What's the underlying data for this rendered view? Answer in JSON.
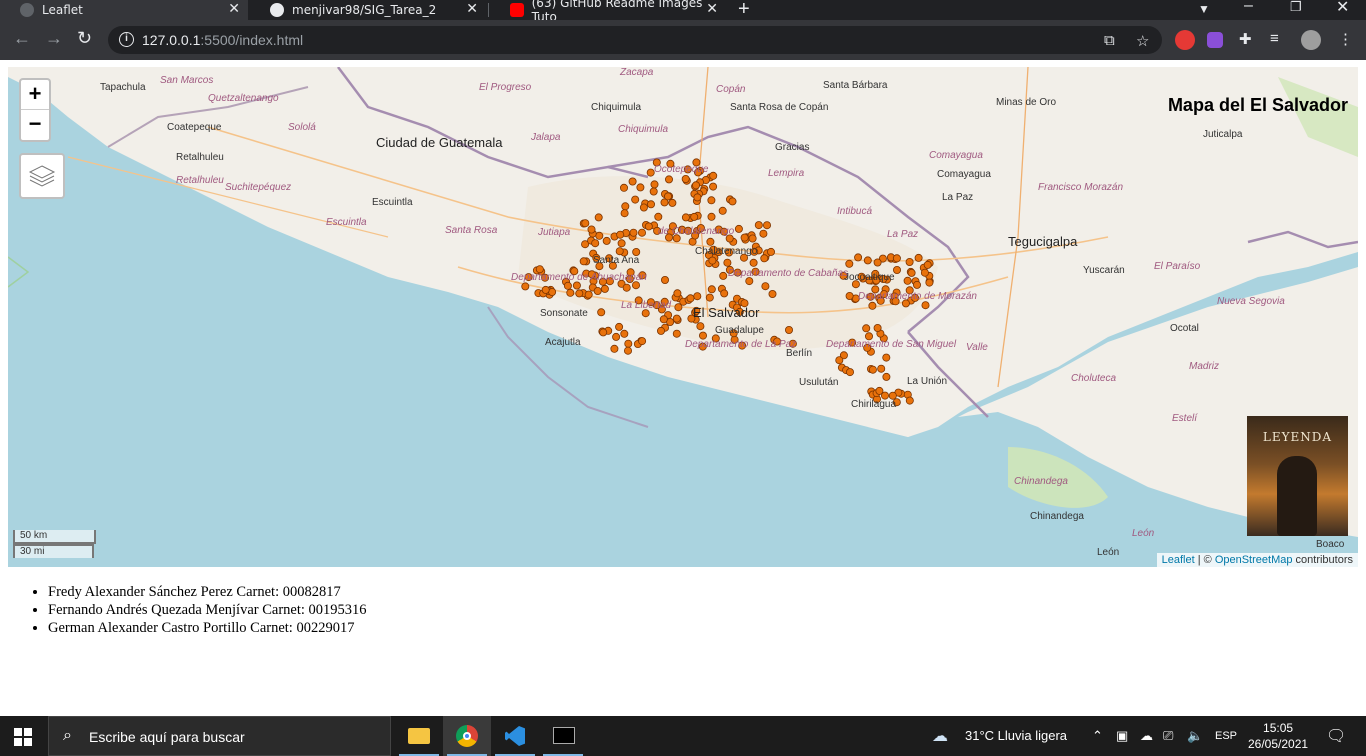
{
  "browser": {
    "tabs": [
      {
        "label": "Leaflet",
        "active": true
      },
      {
        "label": "menjivar98/SIG_Tarea_2",
        "active": false
      },
      {
        "label": "(63) GitHub Readme Images Tuto",
        "active": false
      }
    ],
    "close_glyph": "✕",
    "new_tab_glyph": "+",
    "url_host": "127.0.0.1",
    "url_rest": ":5500/index.html"
  },
  "map": {
    "title": "Mapa del El Salvador",
    "zoom_in": "+",
    "zoom_out": "−",
    "scale_km": "50 km",
    "scale_mi": "30 mi",
    "attribution_leaflet": "Leaflet",
    "attribution_sep": " | © ",
    "attribution_osm": "OpenStreetMap",
    "attribution_tail": " contributors",
    "poster_title": "LEYENDA",
    "places": [
      {
        "name": "Tapachula",
        "cls": ""
      },
      {
        "name": "San Marcos",
        "cls": "dept"
      },
      {
        "name": "Quetzaltenango",
        "cls": "dept"
      },
      {
        "name": "Coatepeque",
        "cls": ""
      },
      {
        "name": "Sololá",
        "cls": "dept"
      },
      {
        "name": "Retalhuleu",
        "cls": ""
      },
      {
        "name": "Retalhuleu",
        "cls": "dept"
      },
      {
        "name": "Suchitepéquez",
        "cls": "dept"
      },
      {
        "name": "Escuintla",
        "cls": ""
      },
      {
        "name": "Escuintla",
        "cls": "dept"
      },
      {
        "name": "Ciudad de Guatemala",
        "cls": "big"
      },
      {
        "name": "El Progreso",
        "cls": "dept"
      },
      {
        "name": "Jalapa",
        "cls": "dept"
      },
      {
        "name": "Chiquimula",
        "cls": ""
      },
      {
        "name": "Chiquimula",
        "cls": "dept"
      },
      {
        "name": "Santa Rosa",
        "cls": "dept"
      },
      {
        "name": "Jutiapa",
        "cls": "dept"
      },
      {
        "name": "Copán",
        "cls": "dept"
      },
      {
        "name": "Santa Rosa de Copán",
        "cls": ""
      },
      {
        "name": "Ocotepeque",
        "cls": "dept"
      },
      {
        "name": "Gracias",
        "cls": ""
      },
      {
        "name": "Lempira",
        "cls": "dept"
      },
      {
        "name": "Santa Bárbara",
        "cls": ""
      },
      {
        "name": "Comayagua",
        "cls": "dept"
      },
      {
        "name": "Comayagua",
        "cls": ""
      },
      {
        "name": "La Paz",
        "cls": ""
      },
      {
        "name": "Intibucá",
        "cls": "dept"
      },
      {
        "name": "La Paz",
        "cls": "dept"
      },
      {
        "name": "Minas de Oro",
        "cls": ""
      },
      {
        "name": "Juticalpa",
        "cls": ""
      },
      {
        "name": "Francisco Morazán",
        "cls": "dept"
      },
      {
        "name": "Tegucigalpa",
        "cls": "big"
      },
      {
        "name": "Yuscarán",
        "cls": ""
      },
      {
        "name": "El Paraíso",
        "cls": "dept"
      },
      {
        "name": "Nueva Segovia",
        "cls": "dept"
      },
      {
        "name": "Ocotal",
        "cls": ""
      },
      {
        "name": "Choluteca",
        "cls": "dept"
      },
      {
        "name": "Madriz",
        "cls": "dept"
      },
      {
        "name": "Estelí",
        "cls": "dept"
      },
      {
        "name": "Chinandega",
        "cls": "dept"
      },
      {
        "name": "Chinandega",
        "cls": ""
      },
      {
        "name": "León",
        "cls": "dept"
      },
      {
        "name": "León",
        "cls": ""
      },
      {
        "name": "Boaco",
        "cls": ""
      },
      {
        "name": "Valle",
        "cls": "dept"
      },
      {
        "name": "La Unión",
        "cls": ""
      },
      {
        "name": "Usulután",
        "cls": ""
      },
      {
        "name": "Chirilagua",
        "cls": ""
      },
      {
        "name": "Departamento de San Miguel",
        "cls": "dept"
      },
      {
        "name": "Berlín",
        "cls": ""
      },
      {
        "name": "Departamento de La Paz",
        "cls": "dept"
      },
      {
        "name": "Guadalupe",
        "cls": ""
      },
      {
        "name": "El Salvador",
        "cls": "big"
      },
      {
        "name": "Sonsonate",
        "cls": ""
      },
      {
        "name": "Acajutla",
        "cls": ""
      },
      {
        "name": "Departamento de Ahuachapán",
        "cls": "dept"
      },
      {
        "name": "Santa Ana",
        "cls": ""
      },
      {
        "name": "Chalatenango",
        "cls": ""
      },
      {
        "name": "de Chalatenango",
        "cls": "dept"
      },
      {
        "name": "Jocoaitique",
        "cls": ""
      },
      {
        "name": "La Libertad",
        "cls": "dept"
      },
      {
        "name": "Departamento de Cabañas",
        "cls": "dept"
      },
      {
        "name": "Departamento de Morazán",
        "cls": "dept"
      },
      {
        "name": "Zacapa",
        "cls": "dept"
      }
    ]
  },
  "authors": [
    "Fredy Alexander Sánchez Perez Carnet: 00082817",
    "Fernando Andrés Quezada Menjívar Carnet: 00195316",
    "German Alexander Castro Portillo Carnet: 00229017"
  ],
  "taskbar": {
    "search_placeholder": "Escribe aquí para buscar",
    "weather": "31°C  Lluvia ligera",
    "lang": "ESP",
    "time": "15:05",
    "date": "26/05/2021"
  },
  "colors": {
    "marker_fill": "#e8720c",
    "marker_stroke": "#7a3300",
    "water": "#aad3df",
    "land": "#f2efe9"
  }
}
